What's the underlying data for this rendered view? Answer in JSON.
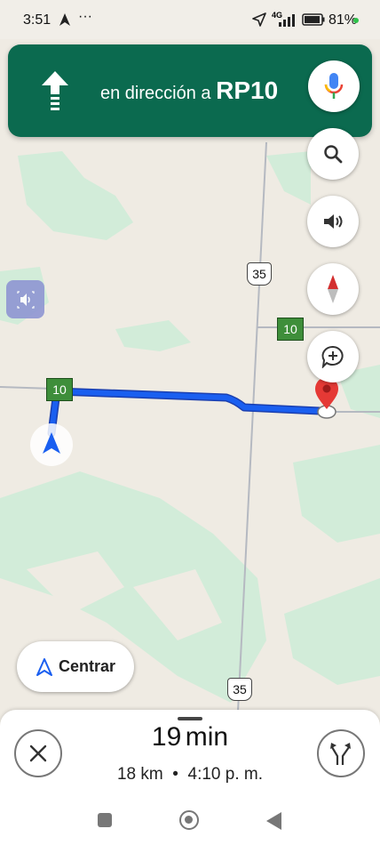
{
  "status_bar": {
    "time": "3:51",
    "signal_label": "4G",
    "battery": "81%"
  },
  "banner": {
    "instruction_prefix": "en dirección a",
    "instruction_road": "RP10",
    "direction_icon": "arrow-up-icon"
  },
  "map": {
    "route_shield_1": "35",
    "route_shield_2": "35",
    "green_sign_1": "10",
    "green_sign_2": "10"
  },
  "recenter": {
    "label": "Centrar"
  },
  "trip": {
    "minutes": "19",
    "minutes_unit": "min",
    "distance": "18 km",
    "separator": "•",
    "arrival": "4:10 p. m."
  },
  "colors": {
    "banner_bg": "#0b6a4f",
    "route": "#1a5ff0",
    "map_bg": "#efebe3",
    "park_green": "#d2ecd9"
  }
}
